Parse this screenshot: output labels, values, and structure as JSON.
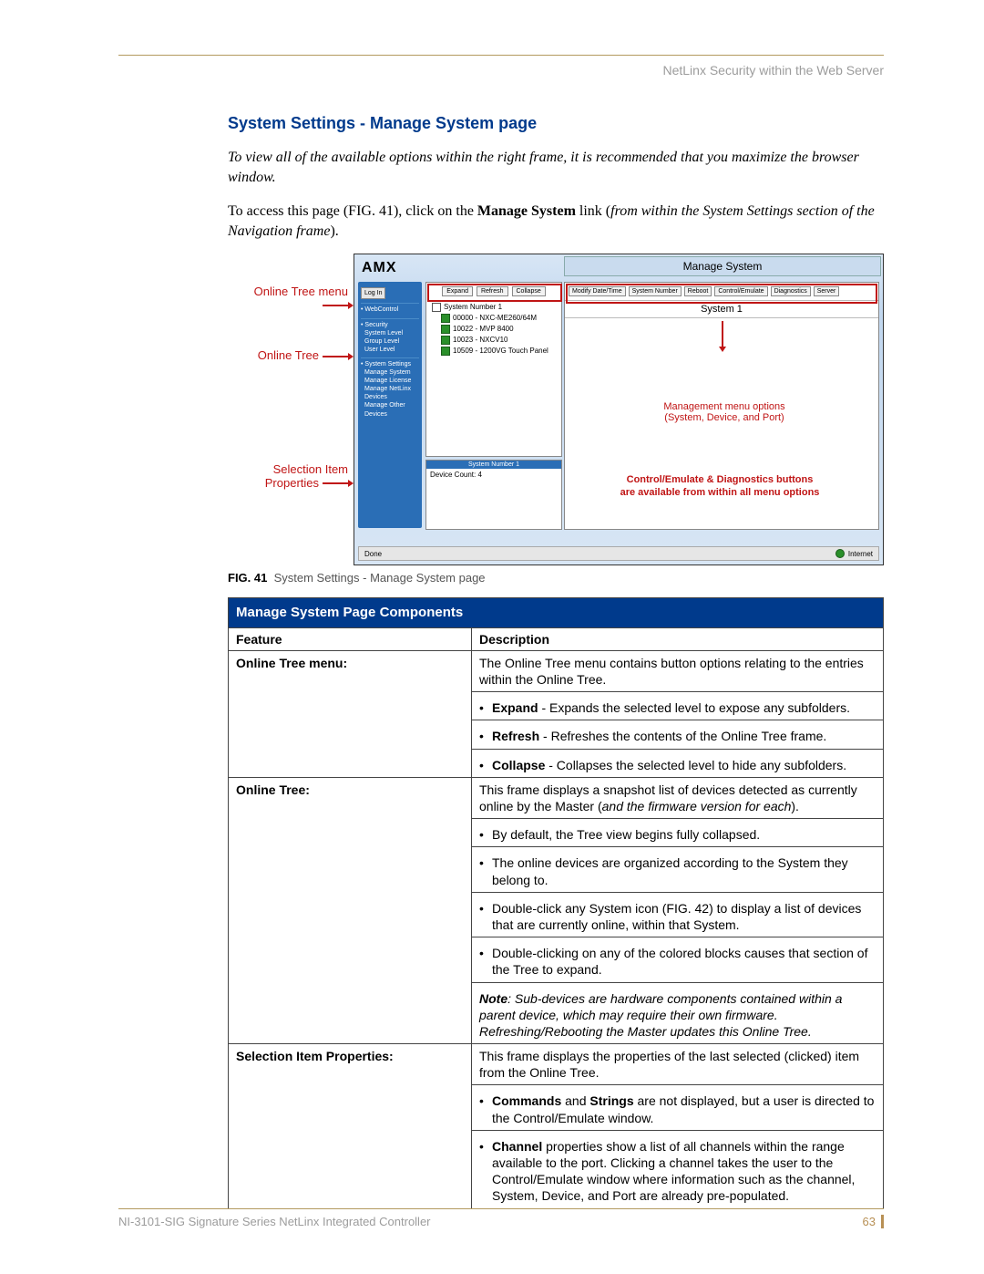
{
  "running_head": "NetLinx Security within the Web Server",
  "heading": "System Settings - Manage System page",
  "para1_italic": "To view all of the available options within the right frame, it is recommended that you maximize the browser window.",
  "para2_pre": "To access this page (FIG. 41), click on the ",
  "para2_bold": "Manage System",
  "para2_post": " link (",
  "para2_italic": "from within the System Settings section of the Navigation frame",
  "para2_end": ").",
  "annotations": {
    "a1": "Online Tree menu",
    "a2": "Online Tree",
    "a3": "Selection Item Properties"
  },
  "diagram": {
    "logo": "AMX",
    "right_header": "Manage System",
    "tree_buttons": [
      "Expand",
      "Refresh",
      "Collapse"
    ],
    "tree_root": "System Number 1",
    "tree_items": [
      "00000 - NXC-ME260/64M",
      "10022 - MVP 8400",
      "10023 - NXCV10",
      "10509 - 1200VG Touch Panel"
    ],
    "sidebar": {
      "login": "Log In",
      "webcontrol": "• WebControl",
      "security": "• Security",
      "security_items": [
        "System Level",
        "Group Level",
        "User Level"
      ],
      "system_settings": "• System Settings",
      "ss_items": [
        "Manage System",
        "Manage License",
        "Manage NetLinx Devices",
        "Manage Other Devices"
      ]
    },
    "prop_header": "System Number 1",
    "prop_body": "Device Count: 4",
    "mgmt_buttons": [
      "Modify Date/Time",
      "System Number",
      "Reboot",
      "Control/Emulate",
      "Diagnostics",
      "Server"
    ],
    "system_line": "System 1",
    "callout1a": "Management menu options",
    "callout1b": "(System, Device, and Port)",
    "callout2a": "Control/Emulate & Diagnostics buttons",
    "callout2b": "are available from within all menu options",
    "status_left": "Done",
    "status_right": "Internet"
  },
  "fig_caption_label": "FIG. 41",
  "fig_caption_text": "System Settings - Manage System page",
  "table": {
    "title": "Manage System Page Components",
    "col1": "Feature",
    "col2": "Description",
    "rows": [
      {
        "feature": "Online Tree menu:",
        "desc_main": "The Online Tree menu contains button options relating to the entries within the Online Tree.",
        "bullets": [
          {
            "b": "Expand",
            "t": " - Expands the selected level to expose any subfolders."
          },
          {
            "b": "Refresh",
            "t": " - Refreshes the contents of the Online Tree frame."
          },
          {
            "b": "Collapse",
            "t": " - Collapses the selected level to hide any subfolders."
          }
        ]
      },
      {
        "feature": "Online Tree:",
        "desc_pre": "This frame displays a snapshot list of devices detected as currently online by the Master (",
        "desc_italic": "and the firmware version for each",
        "desc_post": ").",
        "bullets_plain": [
          "By default, the Tree view begins fully collapsed.",
          "The online devices are organized according to the System they belong to.",
          "Double-click any System icon (FIG. 42) to display a list of devices that are currently online, within that System.",
          "Double-clicking on any of the colored blocks causes that section of the Tree to expand."
        ],
        "note_pre": "Note",
        "note_text": ": Sub-devices are hardware components contained within a parent device, which may require their own firmware. Refreshing/Rebooting the Master updates this Online Tree."
      },
      {
        "feature": "Selection Item Properties:",
        "desc_main": "This frame displays the properties of the last selected (clicked) item from the Online Tree.",
        "mixed_bullets": [
          {
            "parts": [
              {
                "b": "Commands"
              },
              {
                "t": " and "
              },
              {
                "b": "Strings"
              },
              {
                "t": " are not displayed, but a user is directed to the Control/Emulate window."
              }
            ]
          },
          {
            "parts": [
              {
                "b": "Channel"
              },
              {
                "t": " properties show a list of all channels within the range available to the port. Clicking a channel takes the user to the Control/Emulate window where information such as the channel, System, Device, and Port are already pre-populated."
              }
            ]
          }
        ]
      }
    ]
  },
  "footer_left": "NI-3101-SIG Signature Series NetLinx Integrated Controller",
  "footer_page": "63"
}
